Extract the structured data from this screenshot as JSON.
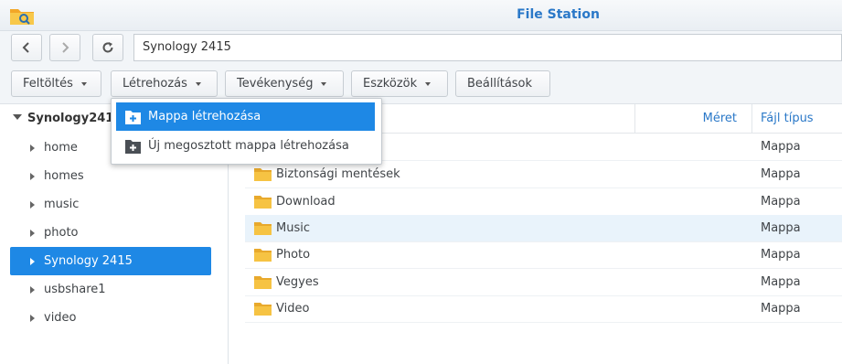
{
  "window": {
    "title": "File Station"
  },
  "nav": {
    "path": "Synology 2415"
  },
  "toolbar": {
    "upload": "Feltöltés",
    "create": "Létrehozás",
    "action": "Tevékenység",
    "tools": "Eszközök",
    "settings": "Beállítások"
  },
  "tree": {
    "root": "Synology2415",
    "items": [
      "home",
      "homes",
      "music",
      "photo",
      "Synology 2415",
      "usbshare1",
      "video"
    ],
    "selected": "Synology 2415"
  },
  "list": {
    "columns": {
      "size": "Méret",
      "type": "Fájl típus"
    },
    "rows": [
      {
        "name": "",
        "type": "Mappa"
      },
      {
        "name": "Biztonsági mentések",
        "type": "Mappa"
      },
      {
        "name": "Download",
        "type": "Mappa"
      },
      {
        "name": "Music",
        "type": "Mappa"
      },
      {
        "name": "Photo",
        "type": "Mappa"
      },
      {
        "name": "Vegyes",
        "type": "Mappa"
      },
      {
        "name": "Video",
        "type": "Mappa"
      }
    ]
  },
  "menu": {
    "create_folder": "Mappa létrehozása",
    "create_shared_folder": "Új megosztott mappa létrehozása"
  },
  "colors": {
    "accent": "#1e88e5",
    "title": "#2a78c8",
    "folder": "#f6c343"
  }
}
